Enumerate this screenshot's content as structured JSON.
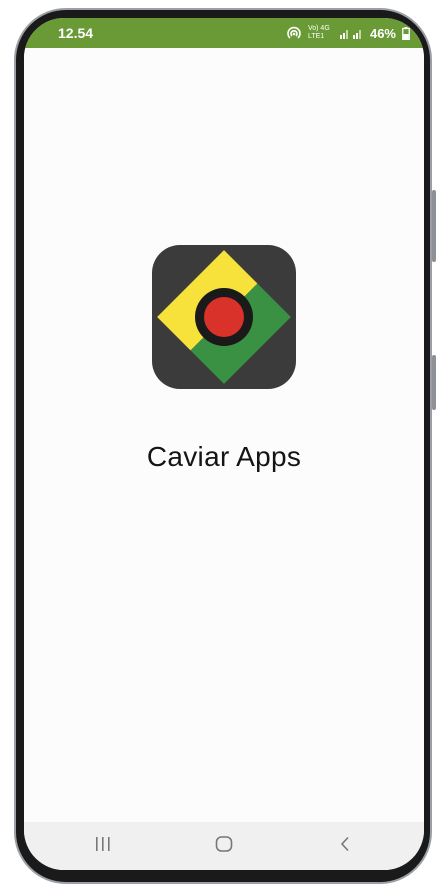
{
  "status_bar": {
    "time": "12.54",
    "network_label": "Vo) 4G LTE1",
    "battery_percent": "46%",
    "icons": [
      "hotspot-icon",
      "signal-icon",
      "battery-icon"
    ]
  },
  "splash": {
    "app_name": "Caviar Apps",
    "logo": {
      "name": "caviar-apps-logo",
      "colors": {
        "background": "#3b3b3b",
        "yellow": "#f7e13b",
        "green": "#3a9143",
        "red": "#d8322a",
        "ring": "#1a1a1a"
      }
    }
  },
  "nav_bar": {
    "buttons": [
      "recent-apps",
      "home",
      "back"
    ]
  },
  "colors": {
    "status_bar": "#6a9a36",
    "screen_background": "#fdfcfd",
    "nav_bar": "#f0f0f0"
  }
}
